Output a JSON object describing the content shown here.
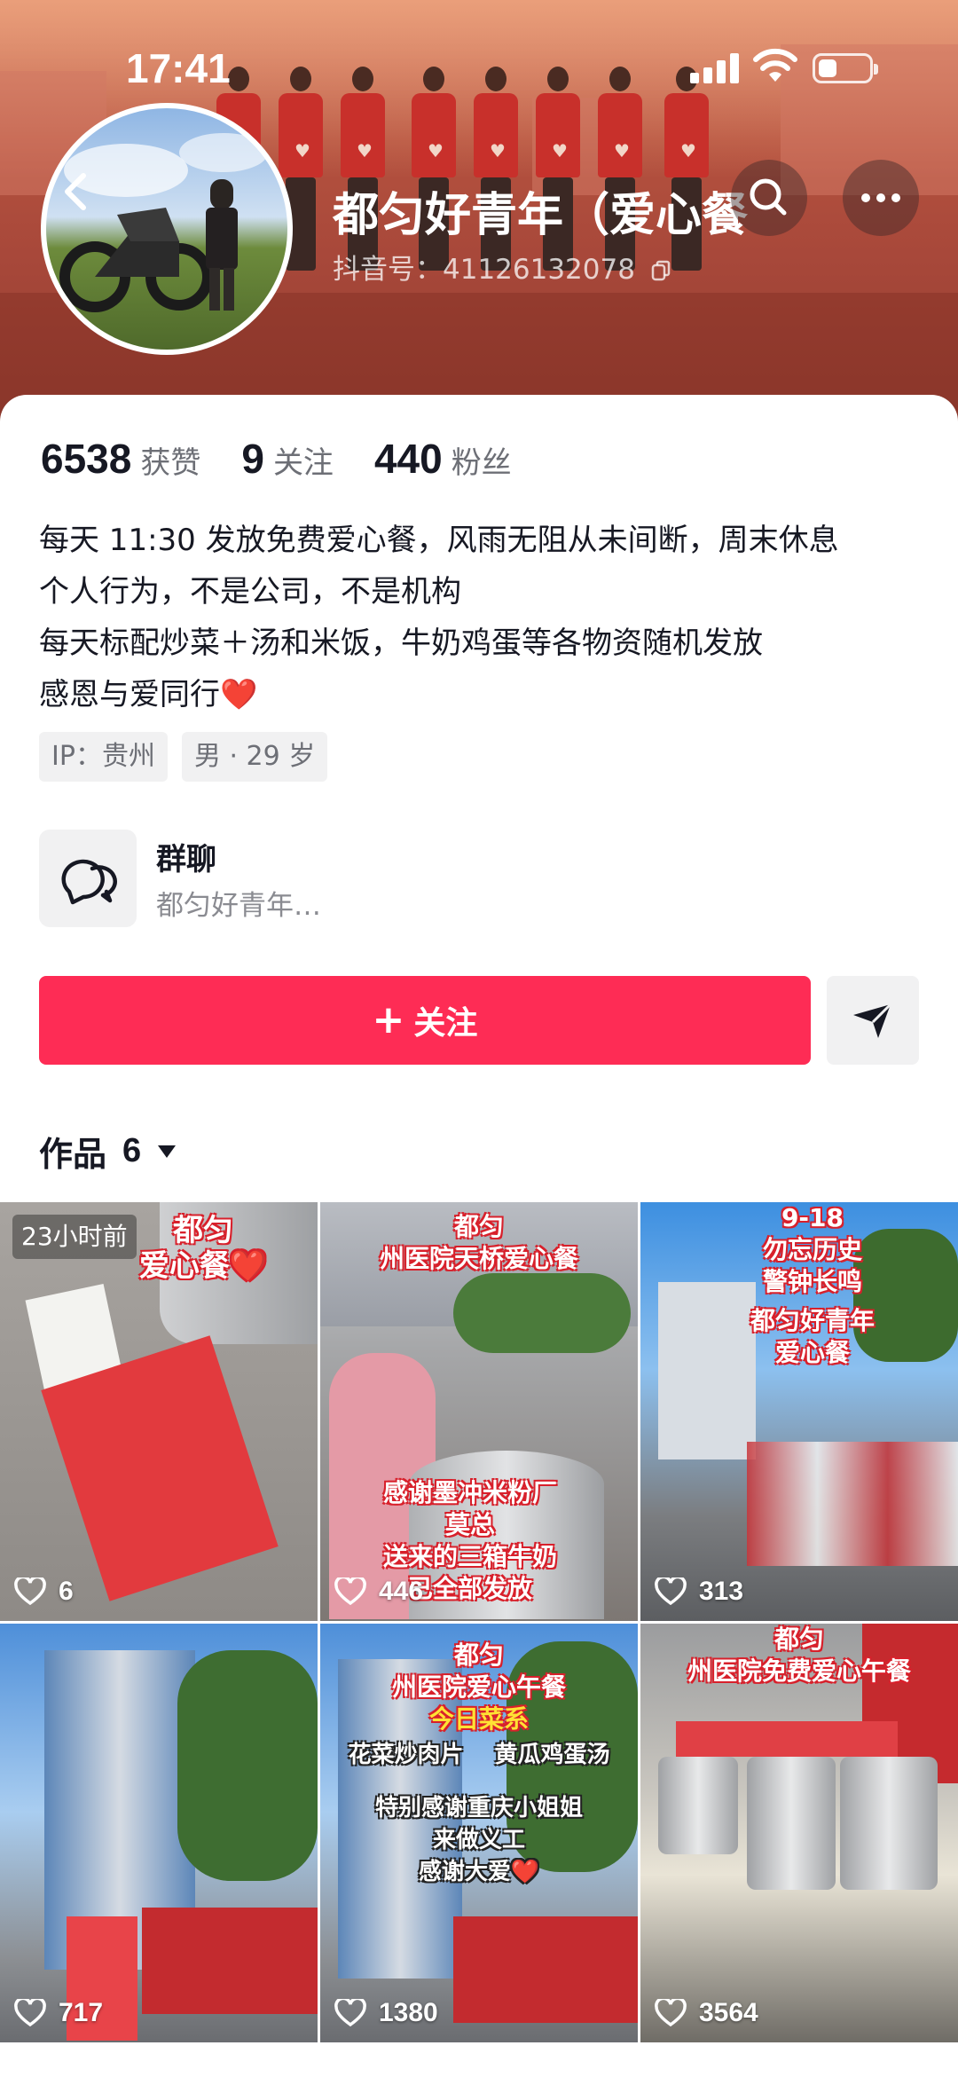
{
  "status_bar": {
    "time": "17:41"
  },
  "profile": {
    "name": "都匀好青年（爱心餐",
    "douyin_id": "抖音号：41126132078"
  },
  "stats": [
    {
      "value": "6538",
      "label": "获赞"
    },
    {
      "value": "9",
      "label": "关注"
    },
    {
      "value": "440",
      "label": "粉丝"
    }
  ],
  "bio": {
    "line1": "每天 11:30 发放免费爱心餐，风雨无阻从未间断，周末休息",
    "line2": "个人行为，不是公司，不是机构",
    "line3": "每天标配炒菜＋汤和米饭，牛奶鸡蛋等各物资随机发放",
    "line4": "感恩与爱同行",
    "line4_emoji": "❤️"
  },
  "tags": {
    "ip": "IP：贵州",
    "gender_age": "男 · 29 岁"
  },
  "group_chat": {
    "title": "群聊",
    "subtitle": "都匀好青年…"
  },
  "actions": {
    "follow_label": "关注"
  },
  "works": {
    "label": "作品",
    "count": "6"
  },
  "videos": [
    {
      "time_badge": "23小时前",
      "caption_lines": [
        "都匀",
        "爱心餐❤️"
      ],
      "likes": "6"
    },
    {
      "caption_lines": [
        "都匀",
        "州医院天桥爱心餐"
      ],
      "bottom_lines": [
        "感谢墨冲米粉厂",
        "莫总",
        "送来的三箱牛奶",
        "已全部发放"
      ],
      "likes": "446"
    },
    {
      "caption_lines": [
        "9-18",
        "勿忘历史",
        "警钟长鸣",
        "都匀好青年",
        "爱心餐"
      ],
      "likes": "313"
    },
    {
      "likes": "717"
    },
    {
      "caption_lines": [
        "都匀",
        "州医院爱心午餐"
      ],
      "menu_title": "今日菜系",
      "menu_items": [
        "花菜炒肉片",
        "黄瓜鸡蛋汤"
      ],
      "bottom_lines": [
        "特别感谢重庆小姐姐",
        "来做义工",
        "感谢大爱❤️"
      ],
      "likes": "1380"
    },
    {
      "caption_lines": [
        "都匀",
        "州医院免费爱心午餐"
      ],
      "likes": "3564"
    }
  ],
  "colors": {
    "follow": "#fe2c55",
    "header": "#a8483a",
    "caption_outline": "#d8202b"
  }
}
